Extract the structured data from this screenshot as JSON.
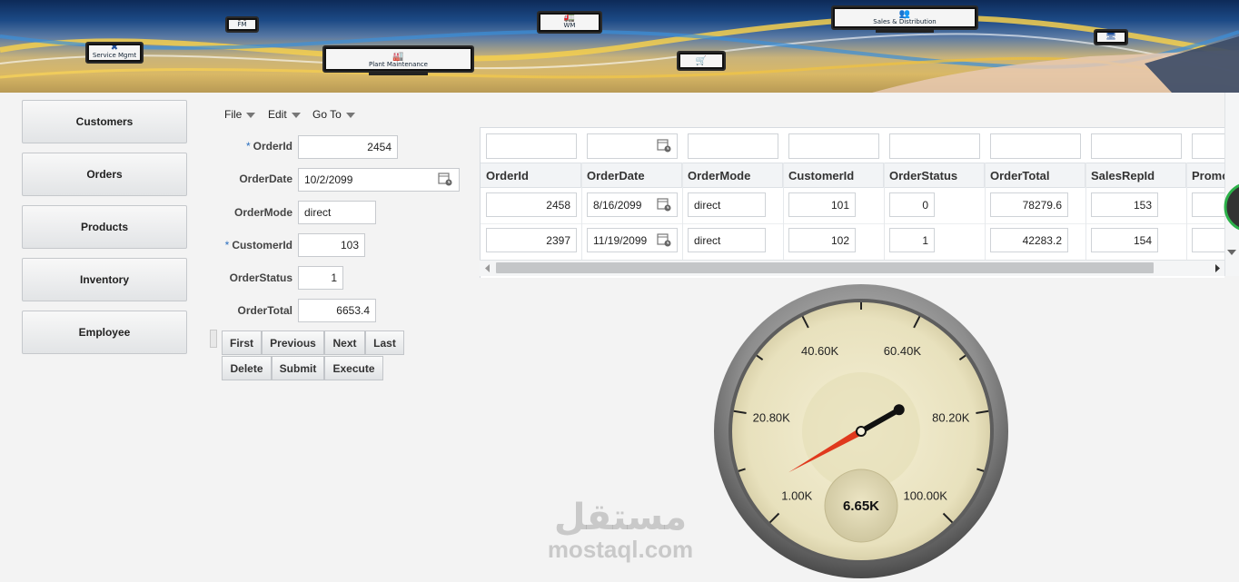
{
  "banner": {
    "devices": [
      {
        "id": "fm",
        "label": "FM",
        "glyph": "🚚"
      },
      {
        "id": "wm",
        "label": "WM",
        "glyph": "🚛"
      },
      {
        "id": "sd",
        "label": "Sales & Distribution",
        "glyph": "👥"
      },
      {
        "id": "service",
        "label": "Service Mgmt",
        "glyph": "✖"
      },
      {
        "id": "plant",
        "label": "Plant Maintenance",
        "glyph": "🏭"
      },
      {
        "id": "shop",
        "label": "",
        "glyph": "🛒"
      },
      {
        "id": "small",
        "label": "",
        "glyph": "🖥"
      }
    ]
  },
  "nav": {
    "items": [
      {
        "label": "Customers"
      },
      {
        "label": "Orders"
      },
      {
        "label": "Products"
      },
      {
        "label": "Inventory"
      },
      {
        "label": "Employee"
      }
    ]
  },
  "menubar": {
    "file": "File",
    "edit": "Edit",
    "goto": "Go To"
  },
  "form": {
    "required_mark": "*",
    "order_id": {
      "label": "OrderId",
      "value": "2454"
    },
    "order_date": {
      "label": "OrderDate",
      "value": "10/2/2099"
    },
    "order_mode": {
      "label": "OrderMode",
      "value": "direct"
    },
    "customer_id": {
      "label": "CustomerId",
      "value": "103"
    },
    "order_status": {
      "label": "OrderStatus",
      "value": "1"
    },
    "order_total": {
      "label": "OrderTotal",
      "value": "6653.4"
    },
    "buttons": {
      "first": "First",
      "previous": "Previous",
      "next": "Next",
      "last": "Last",
      "delete": "Delete",
      "submit": "Submit",
      "execute": "Execute"
    }
  },
  "table": {
    "columns": [
      "OrderId",
      "OrderDate",
      "OrderMode",
      "CustomerId",
      "OrderStatus",
      "OrderTotal",
      "SalesRepId",
      "Promo"
    ],
    "rows": [
      [
        "2458",
        "8/16/2099",
        "direct",
        "101",
        "0",
        "78279.6",
        "153",
        ""
      ],
      [
        "2397",
        "11/19/2099",
        "direct",
        "102",
        "1",
        "42283.2",
        "154",
        ""
      ]
    ]
  },
  "gauge": {
    "min": 1000,
    "max": 100000,
    "value": 6653.4,
    "value_label": "6.65K",
    "tick_labels": [
      "1.00K",
      "20.80K",
      "40.60K",
      "60.40K",
      "80.20K",
      "100.00K"
    ],
    "colors": {
      "needle_tip": "#e0391d",
      "needle_tail": "#111111",
      "face": "#ece6c4",
      "bezel": "#8a8a8a"
    }
  },
  "watermark": {
    "arabic": "مستقل",
    "latin": "mostaql.com"
  },
  "colors": {
    "required": "#2b6fbf",
    "accent_ring": "#2db24a"
  }
}
